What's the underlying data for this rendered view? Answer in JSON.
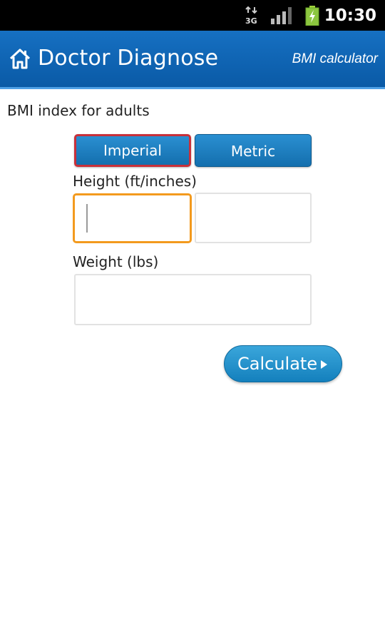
{
  "status_bar": {
    "network": "3G",
    "time": "10:30",
    "icons": [
      "network-3g-icon",
      "signal-strength-icon",
      "battery-charging-icon"
    ]
  },
  "app_bar": {
    "title": "Doctor Diagnose",
    "subtitle": "BMI calculator",
    "icon": "home-icon"
  },
  "page": {
    "heading": "BMI index for adults"
  },
  "units": {
    "imperial_label": "Imperial",
    "metric_label": "Metric",
    "selected": "Imperial"
  },
  "height": {
    "label": "Height (ft/inches)",
    "feet_value": "",
    "inches_value": ""
  },
  "weight": {
    "label": "Weight (lbs)",
    "value": ""
  },
  "actions": {
    "calculate_label": "Calculate"
  },
  "colors": {
    "app_bar": "#0a5aa6",
    "button": "#146fae",
    "selected_outline": "#c8303a",
    "focus_outline": "#f39a1e"
  }
}
